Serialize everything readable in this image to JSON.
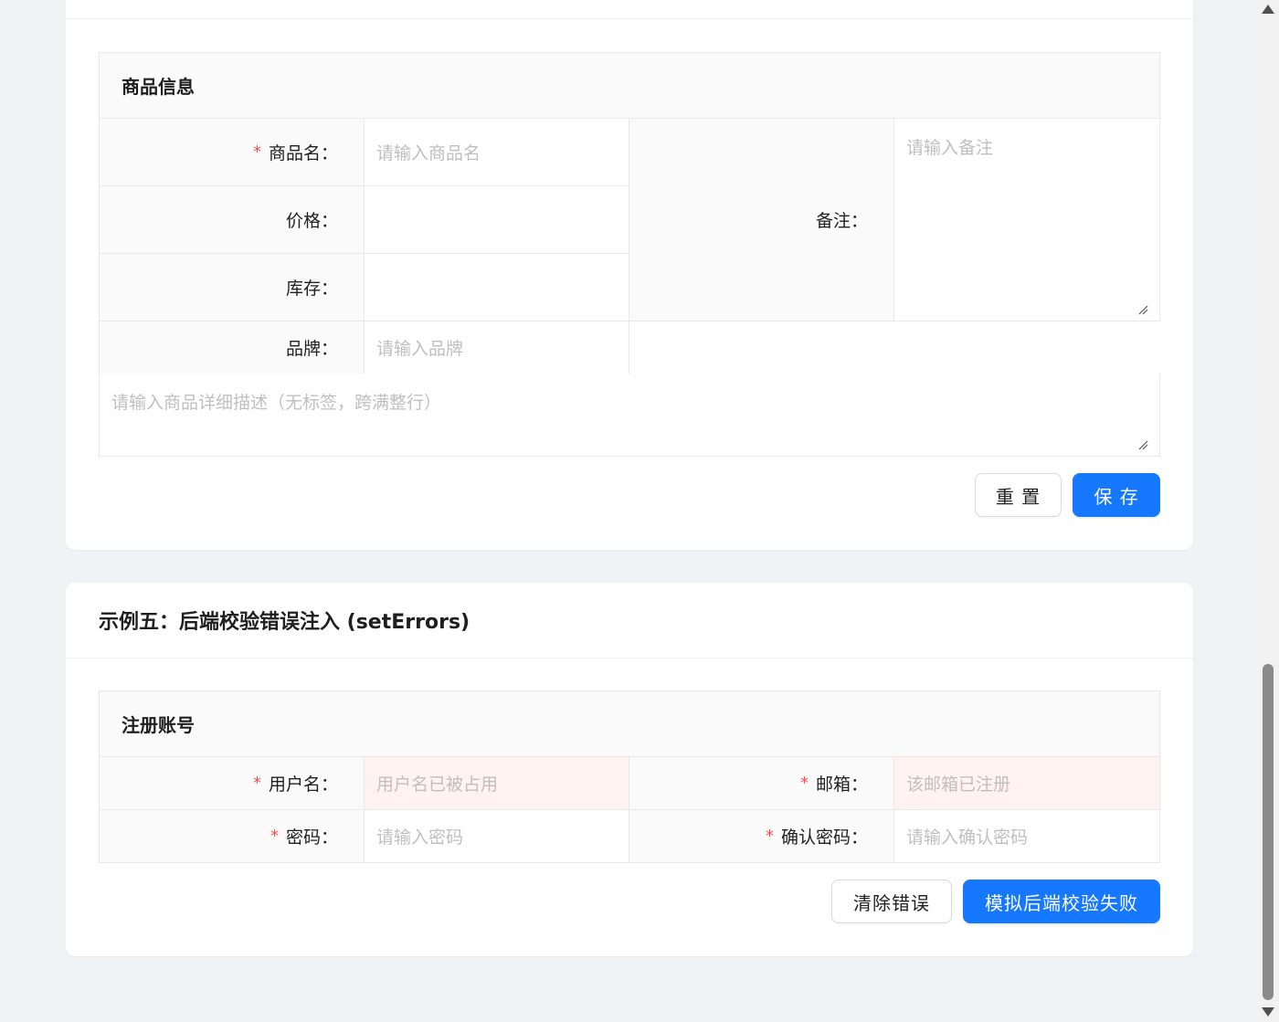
{
  "product_form": {
    "section_title": "商品信息",
    "name_label": "商品名：",
    "name_placeholder": "请输入商品名",
    "price_label": "价格：",
    "price_value": "",
    "stock_label": "库存：",
    "stock_value": "",
    "brand_label": "品牌：",
    "brand_placeholder": "请输入品牌",
    "remark_label": "备注：",
    "remark_placeholder": "请输入备注",
    "description_placeholder": "请输入商品详细描述（无标签，跨满整行）",
    "reset_label": "重 置",
    "save_label": "保 存"
  },
  "example5": {
    "title": "示例五：后端校验错误注入 (setErrors)",
    "section_title": "注册账号",
    "username_label": "用户名：",
    "username_error": "用户名已被占用",
    "email_label": "邮箱：",
    "email_error": "该邮箱已注册",
    "password_label": "密码：",
    "password_placeholder": "请输入密码",
    "confirm_label": "确认密码：",
    "confirm_placeholder": "请输入确认密码",
    "clear_errors_label": "清除错误",
    "simulate_label": "模拟后端校验失败"
  },
  "required_mark": "*",
  "colors": {
    "primary": "#1677ff",
    "required": "#ff4d4f",
    "error_bg": "#fff2f0",
    "label_bg": "#fafafa",
    "page_bg": "#f0f2f5"
  }
}
